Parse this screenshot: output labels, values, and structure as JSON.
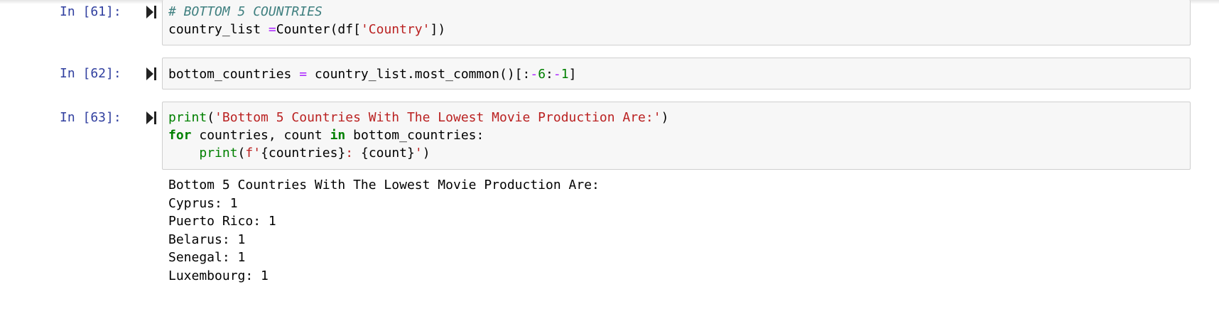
{
  "cells": [
    {
      "prompt": "In [61]:",
      "code": {
        "line1": "# BOTTOM 5 COUNTRIES",
        "line2": {
          "a": "country_list ",
          "op": "=",
          "b": "Counter(df[",
          "str": "'Country'",
          "c": "])"
        }
      }
    },
    {
      "prompt": "In [62]:",
      "code": {
        "line1": {
          "a": "bottom_countries ",
          "op1": "=",
          "b": " country_list.most_common()[:",
          "op2": "-",
          "n1": "6",
          "colon": ":",
          "op3": "-",
          "n2": "1",
          "c": "]"
        }
      }
    },
    {
      "prompt": "In [63]:",
      "code": {
        "line1": {
          "fn": "print",
          "a": "(",
          "str": "'Bottom 5 Countries With The Lowest Movie Production Are:'",
          "b": ")"
        },
        "line2": {
          "kw1": "for",
          "a": " countries, count ",
          "kw2": "in",
          "b": " bottom_countries:"
        },
        "line3": {
          "indent": "    ",
          "fn": "print",
          "a": "(",
          "str1": "f'",
          "b": "{countries}",
          "str2": ": ",
          "c": "{count}",
          "str3": "'",
          "d": ")"
        }
      },
      "output": [
        "Bottom 5 Countries With The Lowest Movie Production Are:",
        "Cyprus: 1",
        "Puerto Rico: 1",
        "Belarus: 1",
        "Senegal: 1",
        "Luxembourg: 1"
      ]
    }
  ],
  "icons": {
    "run": "run-cell-icon"
  },
  "colors": {
    "prompt": "#303f9f",
    "comment": "#408080",
    "string": "#ba2121",
    "operator": "#aa22ff",
    "number": "#008000",
    "keyword": "#008000",
    "cell_bg": "#f7f7f7",
    "cell_border": "#cfcfcf"
  }
}
